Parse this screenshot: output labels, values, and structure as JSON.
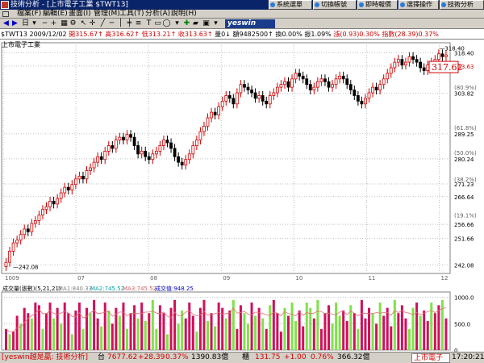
{
  "window": {
    "title": "技術分析 - [上市電子工業 $TWT13]"
  },
  "top_buttons": [
    "系統選單",
    "切換帳號",
    "即時報價",
    "選擇操作",
    "技術分析"
  ],
  "menu": [
    "檔案(F)",
    "編輯(E)",
    "畫面(I)",
    "管理(M)",
    "工具(T)",
    "分析(A)",
    "說明(H)"
  ],
  "toolbar": {
    "period_label": "日",
    "logo": "yeswin"
  },
  "info": {
    "code": "$TWT13",
    "date": "2009/12/02",
    "open": "開315.67",
    "high": "高316.62",
    "low": "低313.21",
    "close": "收313.63",
    "vol_label": "量0",
    "amount": "額9482500",
    "turnover": "換0.00%",
    "amplitude": "振1.09%",
    "change": "漲(0.93)0.30%",
    "index": "指數(28.39)0.37%"
  },
  "chart_title": "上市電子工業",
  "colors": {
    "up": "#d00000",
    "down": "#000000",
    "vol_up": "#d0105a",
    "vol_down": "#7fe24a",
    "grid": "#c0c0c0",
    "ma": "#e07070"
  },
  "chart_data": {
    "type": "candlestick",
    "y_ticks": [
      "318.40",
      "313.63",
      "303.82",
      "289.25",
      "280.24",
      "271.23",
      "266.64",
      "256.66",
      "251.66",
      "242.08"
    ],
    "pct_ticks": [
      "(80.9%)",
      "(61.8%)",
      "(50.0%)",
      "(38.2%)",
      "(19.1%)"
    ],
    "ylim": [
      239,
      322
    ],
    "high_label": "318.40",
    "low_label": "242.08",
    "last_price": "317.62",
    "x_months": [
      "1009",
      "07",
      "08",
      "09",
      "10",
      "11",
      "12"
    ],
    "closes": [
      243,
      247,
      250,
      251,
      253,
      255,
      254,
      257,
      258,
      260,
      262,
      263,
      265,
      264,
      266,
      268,
      270,
      269,
      271,
      273,
      274,
      273,
      276,
      277,
      279,
      281,
      280,
      283,
      285,
      284,
      287,
      288,
      287,
      289,
      288,
      285,
      282,
      283,
      281,
      280,
      282,
      283,
      285,
      287,
      286,
      284,
      281,
      279,
      278,
      280,
      282,
      285,
      287,
      290,
      292,
      295,
      297,
      296,
      299,
      301,
      303,
      302,
      300,
      304,
      307,
      306,
      305,
      304,
      302,
      303,
      301,
      300,
      303,
      304,
      306,
      307,
      308,
      306,
      309,
      311,
      310,
      309,
      307,
      305,
      306,
      308,
      309,
      308,
      306,
      307,
      309,
      310,
      309,
      307,
      305,
      303,
      301,
      300,
      302,
      304,
      306,
      305,
      307,
      309,
      311,
      313,
      315,
      316,
      314,
      315,
      317,
      316,
      315,
      313,
      312,
      314,
      315,
      316,
      318,
      317,
      317.62
    ],
    "volume_title": "成交量(張數)(5,21,21)",
    "volume_legend": [
      "MA1:840.33",
      "MA2:745.52",
      "MA3:745.52",
      "成交值:948.25"
    ],
    "volume_ticks": [
      "1000.0",
      "500.0",
      "0"
    ],
    "volume_max": 1100,
    "volumes": [
      400,
      300,
      350,
      650,
      500,
      800,
      700,
      600,
      900,
      850,
      400,
      700,
      900,
      600,
      800,
      500,
      900,
      700,
      300,
      750,
      900,
      400,
      800,
      700,
      950,
      600,
      450,
      900,
      750,
      500,
      800,
      650,
      900,
      400,
      700,
      850,
      600,
      900,
      550,
      700,
      950,
      400,
      850,
      700,
      300,
      800,
      950,
      500,
      750,
      600,
      900,
      650,
      350,
      800,
      950,
      550,
      700,
      450,
      900,
      800,
      600,
      750,
      950,
      400,
      850,
      700,
      500,
      900,
      650,
      800,
      600,
      400,
      850,
      950,
      700,
      350,
      800,
      650,
      900,
      550,
      750,
      450,
      900,
      800,
      600,
      950,
      400,
      700,
      850,
      500,
      900,
      650,
      750,
      550,
      850,
      700,
      400,
      950,
      600,
      800,
      700,
      500,
      900,
      650,
      800,
      450,
      950,
      700,
      850,
      600,
      400,
      800,
      900,
      650,
      750,
      550,
      900,
      700,
      850,
      950,
      600
    ],
    "volume_up": [
      1,
      0,
      1,
      1,
      0,
      1,
      1,
      0,
      1,
      1,
      0,
      1,
      1,
      0,
      1,
      0,
      1,
      1,
      0,
      1,
      1,
      0,
      1,
      0,
      1,
      1,
      0,
      1,
      0,
      1,
      1,
      0,
      1,
      0,
      1,
      1,
      0,
      1,
      0,
      1,
      0,
      0,
      1,
      1,
      0,
      1,
      1,
      0,
      0,
      1,
      1,
      1,
      0,
      1,
      1,
      0,
      1,
      0,
      1,
      1,
      0,
      1,
      0,
      1,
      1,
      0,
      0,
      1,
      0,
      1,
      0,
      1,
      0,
      1,
      1,
      1,
      0,
      1,
      0,
      0,
      1,
      1,
      0,
      0,
      1,
      0,
      1,
      1,
      1,
      0,
      0,
      0,
      1,
      1,
      0,
      1,
      0,
      1,
      1,
      1,
      0,
      1,
      0,
      1,
      1,
      1,
      0,
      1,
      1,
      1,
      0,
      0,
      1,
      0,
      1,
      1,
      0,
      1,
      1,
      0,
      1
    ]
  },
  "status": {
    "brand": "[yeswin越是贏: 技術分析]",
    "tw_label": "台",
    "tw_value": "7677.62",
    "tw_change": "+28.39",
    "tw_pct": "0.37%",
    "tw_amount": "1390.83億",
    "otc_label": "櫃",
    "otc_value": "131.75",
    "otc_change": "+1.00",
    "otc_pct": "0.76%",
    "otc_amount": "366.32億",
    "tab": "上市電子",
    "time": "17:20:21"
  }
}
